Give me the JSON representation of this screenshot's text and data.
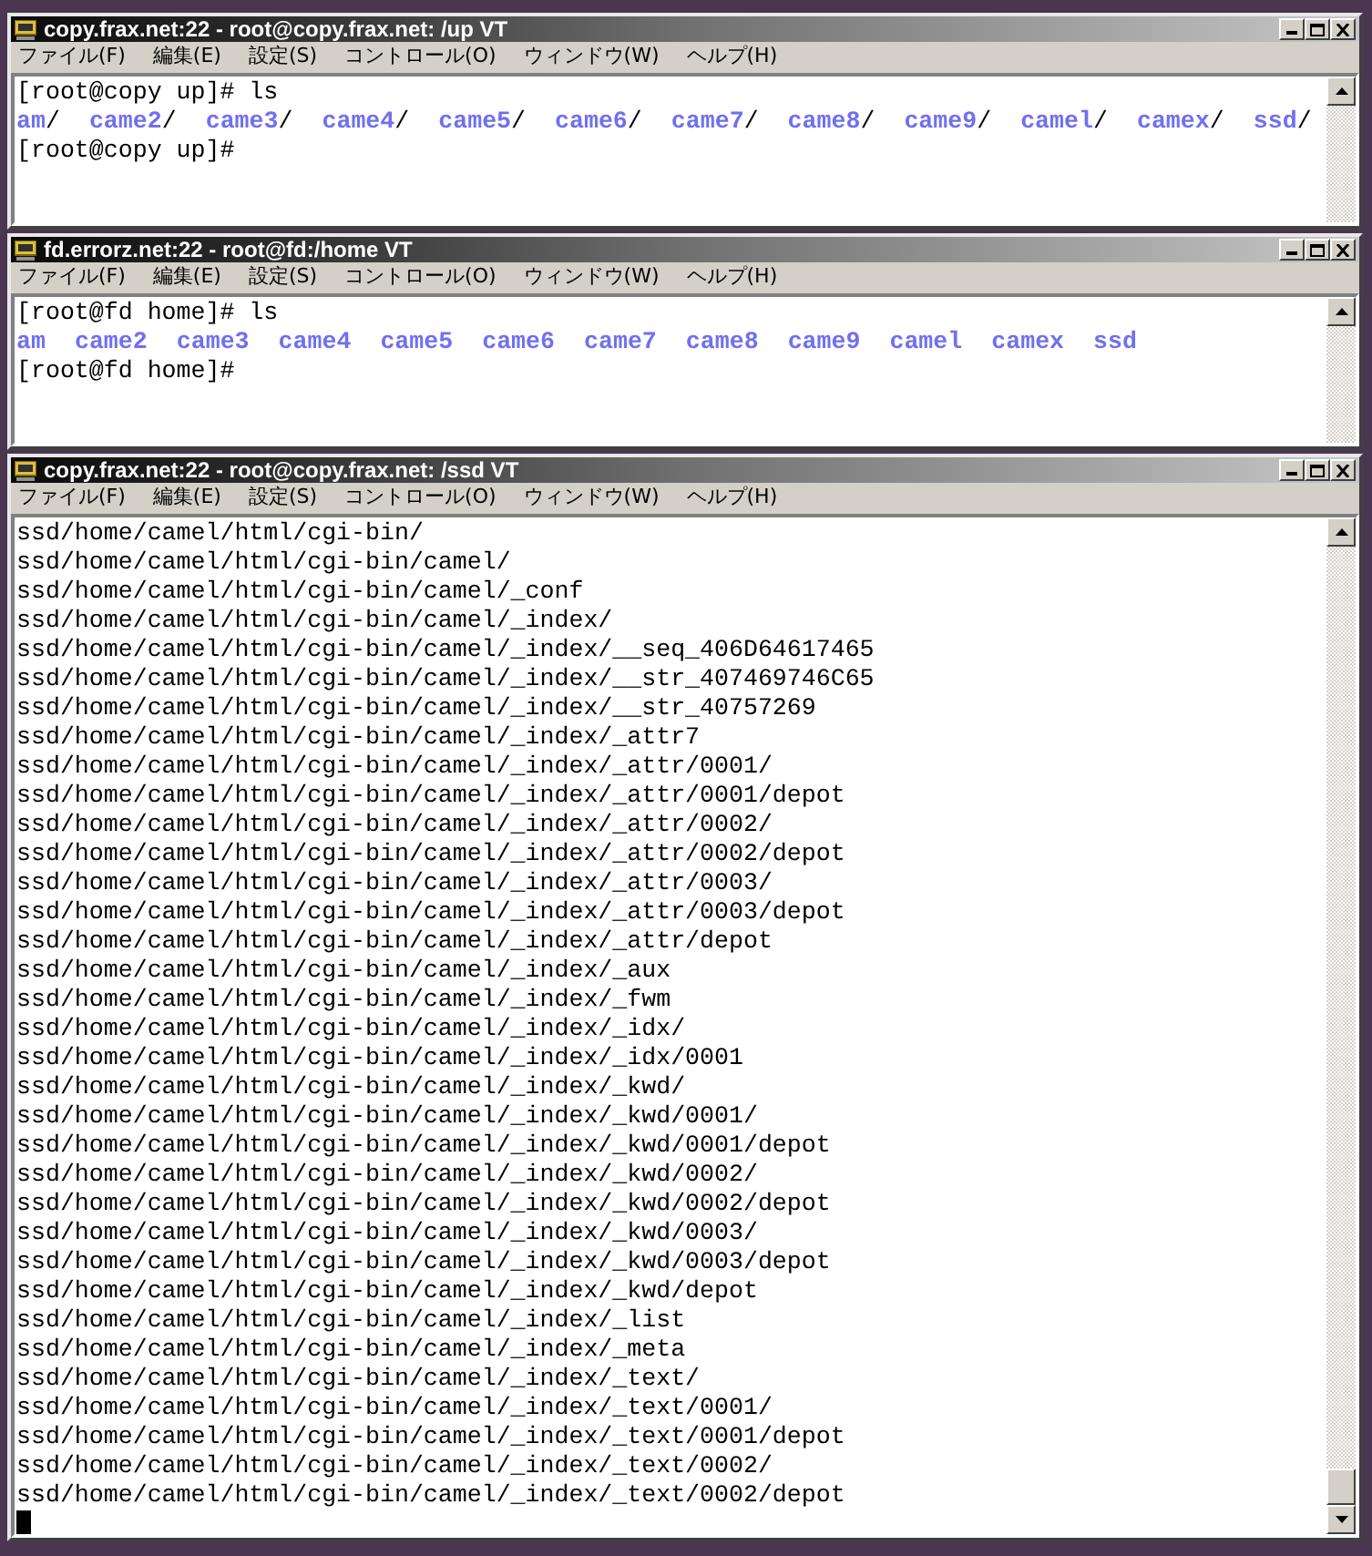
{
  "windows": [
    {
      "title": "copy.frax.net:22 - root@copy.frax.net: /up VT",
      "tall": false,
      "menu": [
        "ファイル(F)",
        "編集(E)",
        "設定(S)",
        "コントロール(O)",
        "ウィンドウ(W)",
        "ヘルプ(H)"
      ],
      "lines": [
        {
          "kind": "text",
          "text": "[root@copy up]# ls"
        },
        {
          "kind": "listing",
          "entries": [
            {
              "name": "am",
              "suffix": "/"
            },
            {
              "name": "came2",
              "suffix": "/"
            },
            {
              "name": "came3",
              "suffix": "/"
            },
            {
              "name": "came4",
              "suffix": "/"
            },
            {
              "name": "came5",
              "suffix": "/"
            },
            {
              "name": "came6",
              "suffix": "/"
            },
            {
              "name": "came7",
              "suffix": "/"
            },
            {
              "name": "came8",
              "suffix": "/"
            },
            {
              "name": "came9",
              "suffix": "/"
            },
            {
              "name": "camel",
              "suffix": "/"
            },
            {
              "name": "camex",
              "suffix": "/"
            },
            {
              "name": "ssd",
              "suffix": "/"
            }
          ]
        },
        {
          "kind": "text",
          "text": "[root@copy up]#"
        }
      ]
    },
    {
      "title": "fd.errorz.net:22 - root@fd:/home VT",
      "tall": false,
      "menu": [
        "ファイル(F)",
        "編集(E)",
        "設定(S)",
        "コントロール(O)",
        "ウィンドウ(W)",
        "ヘルプ(H)"
      ],
      "lines": [
        {
          "kind": "text",
          "text": "[root@fd home]# ls"
        },
        {
          "kind": "listing",
          "entries": [
            {
              "name": "am"
            },
            {
              "name": "came2"
            },
            {
              "name": "came3"
            },
            {
              "name": "came4"
            },
            {
              "name": "came5"
            },
            {
              "name": "came6"
            },
            {
              "name": "came7"
            },
            {
              "name": "came8"
            },
            {
              "name": "came9"
            },
            {
              "name": "camel"
            },
            {
              "name": "camex"
            },
            {
              "name": "ssd"
            }
          ]
        },
        {
          "kind": "text",
          "text": "[root@fd home]#"
        }
      ]
    },
    {
      "title": "copy.frax.net:22 - root@copy.frax.net: /ssd VT",
      "menu": [
        "ファイル(F)",
        "編集(E)",
        "設定(S)",
        "コントロール(O)",
        "ウィンドウ(W)",
        "ヘルプ(H)"
      ],
      "tall": true,
      "cursor": true,
      "lines": [
        {
          "kind": "text",
          "text": "ssd/home/camel/html/cgi-bin/"
        },
        {
          "kind": "text",
          "text": "ssd/home/camel/html/cgi-bin/camel/"
        },
        {
          "kind": "text",
          "text": "ssd/home/camel/html/cgi-bin/camel/_conf"
        },
        {
          "kind": "text",
          "text": "ssd/home/camel/html/cgi-bin/camel/_index/"
        },
        {
          "kind": "text",
          "text": "ssd/home/camel/html/cgi-bin/camel/_index/__seq_406D64617465"
        },
        {
          "kind": "text",
          "text": "ssd/home/camel/html/cgi-bin/camel/_index/__str_407469746C65"
        },
        {
          "kind": "text",
          "text": "ssd/home/camel/html/cgi-bin/camel/_index/__str_40757269"
        },
        {
          "kind": "text",
          "text": "ssd/home/camel/html/cgi-bin/camel/_index/_attr7"
        },
        {
          "kind": "text",
          "text": "ssd/home/camel/html/cgi-bin/camel/_index/_attr/0001/"
        },
        {
          "kind": "text",
          "text": "ssd/home/camel/html/cgi-bin/camel/_index/_attr/0001/depot"
        },
        {
          "kind": "text",
          "text": "ssd/home/camel/html/cgi-bin/camel/_index/_attr/0002/"
        },
        {
          "kind": "text",
          "text": "ssd/home/camel/html/cgi-bin/camel/_index/_attr/0002/depot"
        },
        {
          "kind": "text",
          "text": "ssd/home/camel/html/cgi-bin/camel/_index/_attr/0003/"
        },
        {
          "kind": "text",
          "text": "ssd/home/camel/html/cgi-bin/camel/_index/_attr/0003/depot"
        },
        {
          "kind": "text",
          "text": "ssd/home/camel/html/cgi-bin/camel/_index/_attr/depot"
        },
        {
          "kind": "text",
          "text": "ssd/home/camel/html/cgi-bin/camel/_index/_aux"
        },
        {
          "kind": "text",
          "text": "ssd/home/camel/html/cgi-bin/camel/_index/_fwm"
        },
        {
          "kind": "text",
          "text": "ssd/home/camel/html/cgi-bin/camel/_index/_idx/"
        },
        {
          "kind": "text",
          "text": "ssd/home/camel/html/cgi-bin/camel/_index/_idx/0001"
        },
        {
          "kind": "text",
          "text": "ssd/home/camel/html/cgi-bin/camel/_index/_kwd/"
        },
        {
          "kind": "text",
          "text": "ssd/home/camel/html/cgi-bin/camel/_index/_kwd/0001/"
        },
        {
          "kind": "text",
          "text": "ssd/home/camel/html/cgi-bin/camel/_index/_kwd/0001/depot"
        },
        {
          "kind": "text",
          "text": "ssd/home/camel/html/cgi-bin/camel/_index/_kwd/0002/"
        },
        {
          "kind": "text",
          "text": "ssd/home/camel/html/cgi-bin/camel/_index/_kwd/0002/depot"
        },
        {
          "kind": "text",
          "text": "ssd/home/camel/html/cgi-bin/camel/_index/_kwd/0003/"
        },
        {
          "kind": "text",
          "text": "ssd/home/camel/html/cgi-bin/camel/_index/_kwd/0003/depot"
        },
        {
          "kind": "text",
          "text": "ssd/home/camel/html/cgi-bin/camel/_index/_kwd/depot"
        },
        {
          "kind": "text",
          "text": "ssd/home/camel/html/cgi-bin/camel/_index/_list"
        },
        {
          "kind": "text",
          "text": "ssd/home/camel/html/cgi-bin/camel/_index/_meta"
        },
        {
          "kind": "text",
          "text": "ssd/home/camel/html/cgi-bin/camel/_index/_text/"
        },
        {
          "kind": "text",
          "text": "ssd/home/camel/html/cgi-bin/camel/_index/_text/0001/"
        },
        {
          "kind": "text",
          "text": "ssd/home/camel/html/cgi-bin/camel/_index/_text/0001/depot"
        },
        {
          "kind": "text",
          "text": "ssd/home/camel/html/cgi-bin/camel/_index/_text/0002/"
        },
        {
          "kind": "text",
          "text": "ssd/home/camel/html/cgi-bin/camel/_index/_text/0002/depot"
        }
      ]
    }
  ]
}
